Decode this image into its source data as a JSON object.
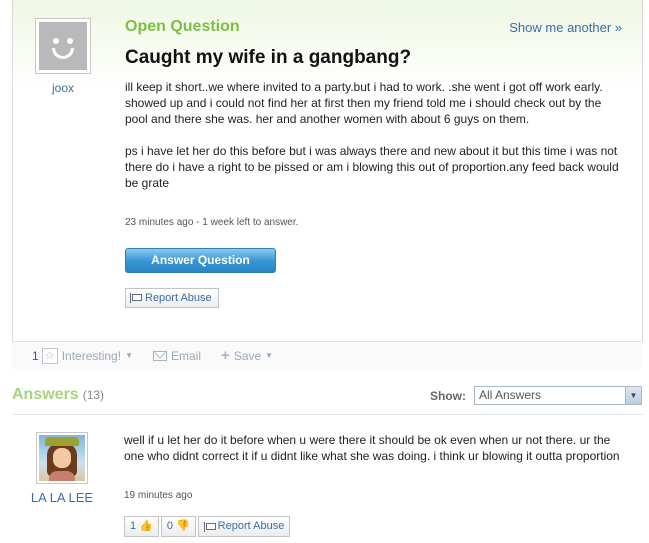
{
  "question": {
    "label": "Open Question",
    "show_another": "Show me another »",
    "title": "Caught my wife in a gangbang?",
    "asker": {
      "name": "joox",
      "avatar": "default-smiley-avatar"
    },
    "body_p1": "ill keep it short..we where invited to a party.but i had to work. .she went i got off work early. showed up and i could not find her at first then my friend told me i should check out by the pool and there she was. her and another women with about 6 guys on them.",
    "body_p2": "ps i have let her do this before but i was always there and new about it but this time i was not there do i have a right to be pissed or am i blowing this out of proportion.any feed back would be grate",
    "meta": "23 minutes ago - 1 week left to answer.",
    "answer_button": "Answer Question",
    "report_abuse": "Report Abuse"
  },
  "actions": {
    "interesting_count": "1",
    "interesting": "Interesting!",
    "email": "Email",
    "save": "Save"
  },
  "answers": {
    "title": "Answers",
    "count": "(13)",
    "show_label": "Show:",
    "show_value": "All Answers",
    "items": [
      {
        "name": "LA LA LEE",
        "text": "well if u let her do it before when u were there it should be ok even when ur not there. ur the one who didnt correct it if u didnt like what she was doing. i think ur blowing it outta proportion",
        "meta": "19 minutes ago",
        "thumbs_up": "1",
        "thumbs_down": "0",
        "report_abuse": "Report Abuse"
      }
    ]
  },
  "colors": {
    "green": "#7dbf43",
    "link": "#3a6ea5",
    "button_blue": "#3a98d6"
  }
}
